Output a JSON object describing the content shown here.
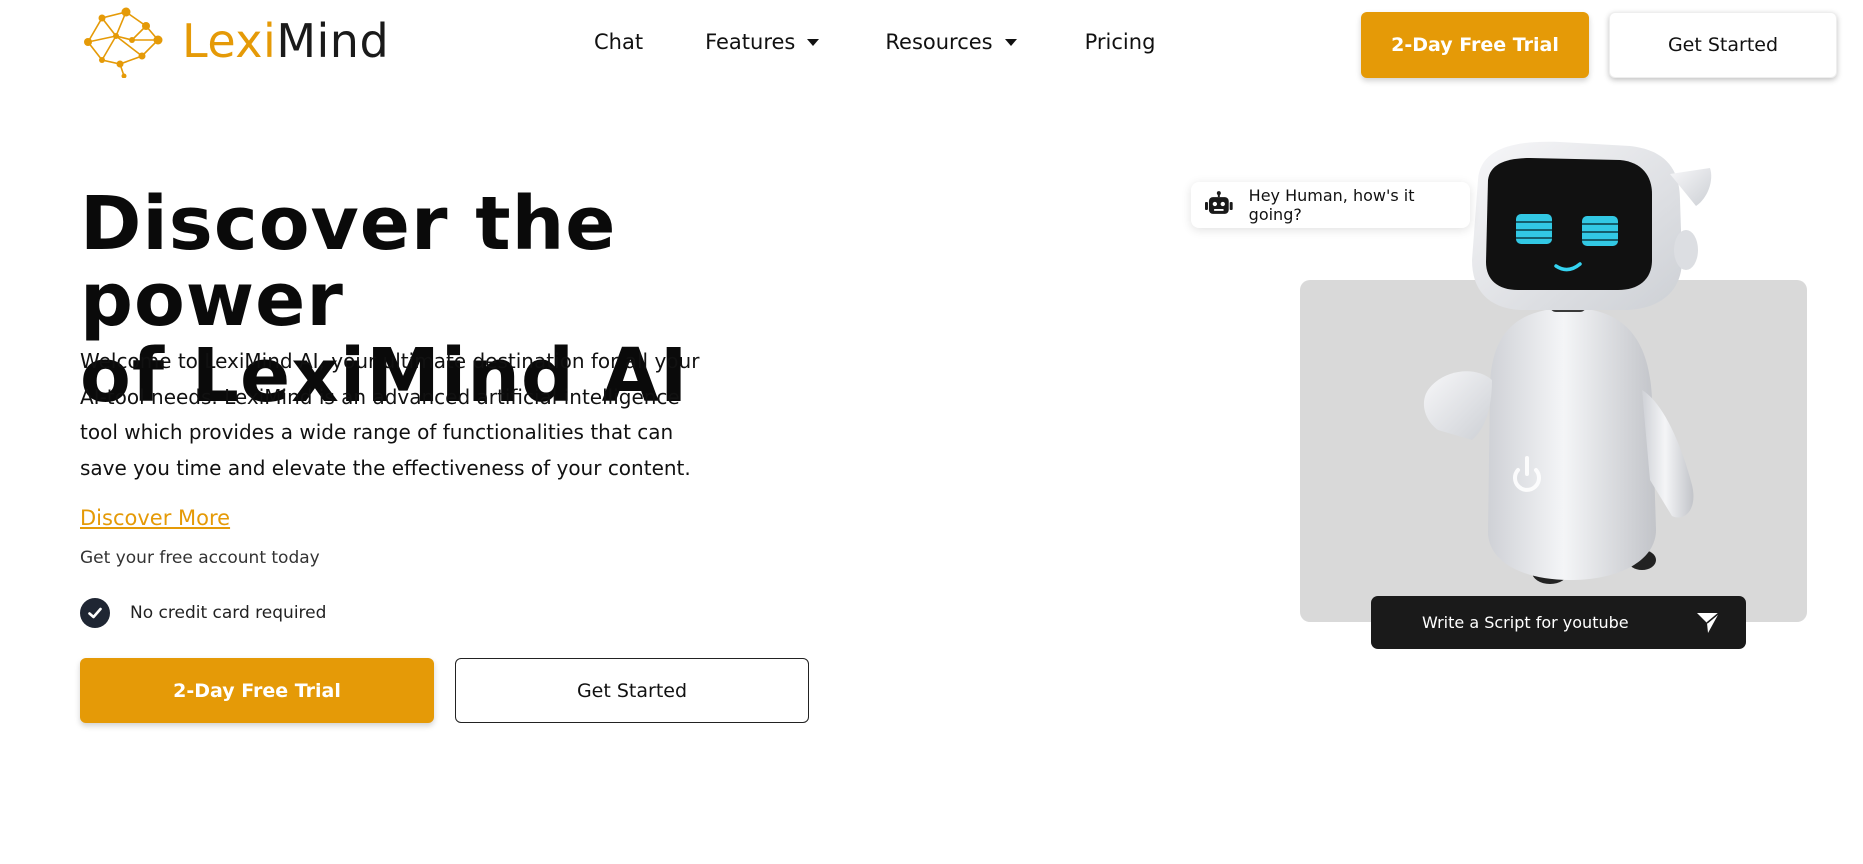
{
  "header": {
    "logo_part1": "Lexi",
    "logo_part2": "Mind",
    "nav": {
      "chat": "Chat",
      "features": "Features",
      "resources": "Resources",
      "pricing": "Pricing"
    },
    "trial_label": "2-Day Free Trial",
    "get_started_label": "Get Started"
  },
  "hero": {
    "title_line1": "Discover the power",
    "title_line2": "of LexiMind AI",
    "description": "Welcome to LexiMind AI, your ultimate destination for all your AI-tool needs. LexiMind is an advanced artificial intelligence tool which provides a wide range of functionalities that can save you time and elevate the effectiveness of your content.",
    "discover_link": "Discover More",
    "free_account": "Get your free account today",
    "no_credit_card": "No credit card required",
    "trial_label": "2-Day Free Trial",
    "get_started_label": "Get Started"
  },
  "illustration": {
    "bubble_text": "Hey Human, how's it going?",
    "prompt_text": "Write a Script for youtube"
  },
  "colors": {
    "accent": "#e59a07",
    "dark": "#1a1a1a",
    "panel": "#d9d9d9"
  },
  "icons": [
    "logo-network-icon",
    "caret-down-icon",
    "check-circle-icon",
    "robot-icon",
    "send-icon"
  ]
}
